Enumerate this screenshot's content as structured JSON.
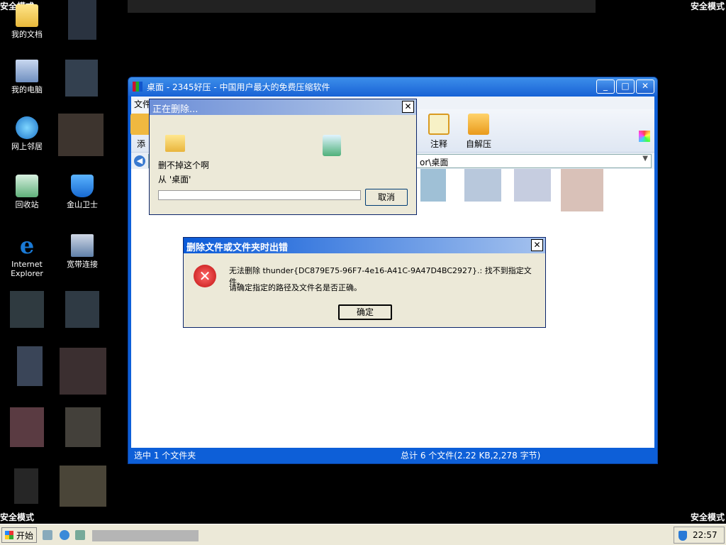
{
  "safe_mode_label": "安全模式",
  "desktop_icons": [
    {
      "label": "我的文档"
    },
    {
      "label": "我的电脑"
    },
    {
      "label": "网上邻居"
    },
    {
      "label": "回收站"
    },
    {
      "label": "金山卫士"
    },
    {
      "label": "Internet Explorer"
    },
    {
      "label": "宽带连接"
    }
  ],
  "main_window": {
    "title": "桌面 - 2345好压 - 中国用户最大的免费压缩软件",
    "menu_first": "文件",
    "toolbar_visible": [
      "添",
      "注释",
      "自解压"
    ],
    "address_fragment": "or\\桌面",
    "status_left": "选中 1 个文件夹",
    "status_right": "总计 6 个文件(2.22 KB,2,278 字节)"
  },
  "deleting_dialog": {
    "title": "正在删除...",
    "item_name": "删不掉这个啊",
    "from_text": "从 '桌面'",
    "cancel_label": "取消",
    "progress": 0
  },
  "error_dialog": {
    "title": "删除文件或文件夹时出错",
    "message_line1": "无法删除 thunder{DC879E75-96F7-4e16-A41C-9A47D4BC2927}.: 找不到指定文件。",
    "message_line2": "请确定指定的路径及文件名是否正确。",
    "ok_label": "确定"
  },
  "taskbar": {
    "start_label": "开始",
    "clock": "22:57"
  },
  "colors": {
    "xp_blue": "#0d5fd8",
    "dialog_bg": "#ece9d8",
    "error_red": "#d92020"
  }
}
